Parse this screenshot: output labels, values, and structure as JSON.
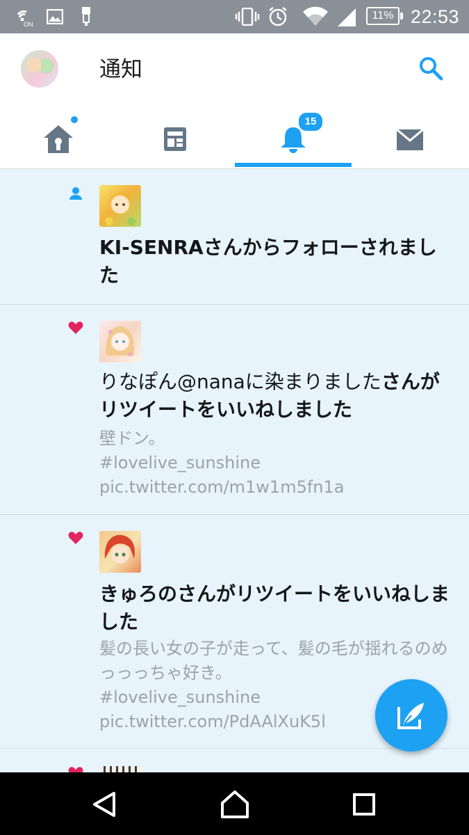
{
  "status_bar": {
    "time": "22:53",
    "battery": "11%",
    "icons": [
      "nfc-on-icon",
      "image-icon",
      "usb-icon",
      "vibrate-icon",
      "alarm-icon",
      "wifi-icon",
      "signal-icon",
      "battery-icon"
    ]
  },
  "header": {
    "title": "通知",
    "tabs": [
      {
        "name": "home",
        "icon": "home-icon",
        "has_dot": true
      },
      {
        "name": "moments",
        "icon": "moments-icon"
      },
      {
        "name": "notifications",
        "icon": "bell-icon",
        "badge": "15",
        "active": true
      },
      {
        "name": "messages",
        "icon": "envelope-icon"
      }
    ]
  },
  "notifications": [
    {
      "type": "follow",
      "icon": "person-icon",
      "name": "KI-SENRA",
      "action": "さんからフォローされました"
    },
    {
      "type": "like",
      "icon": "heart-icon",
      "name": "りなぽん@nanaに染まりました",
      "action": "さんがリツイートをいいねしました",
      "text": "壁ドン。\n#lovelive_sunshine pic.twitter.com/m1w1m5fn1a"
    },
    {
      "type": "like",
      "icon": "heart-icon",
      "name": "きゅろの",
      "action": "さんがリツイートをいいねしました",
      "text": "髪の長い女の子が走って、髪の毛が揺れるのめっっっちゃ好き。\n#lovelive_sunshine pic.twitter.com/PdAAlXuK5l"
    }
  ],
  "colors": {
    "accent": "#1da1f2",
    "like": "#e0245e",
    "feed_bg": "#e8f4fc",
    "status_bar": "#8a9098"
  }
}
